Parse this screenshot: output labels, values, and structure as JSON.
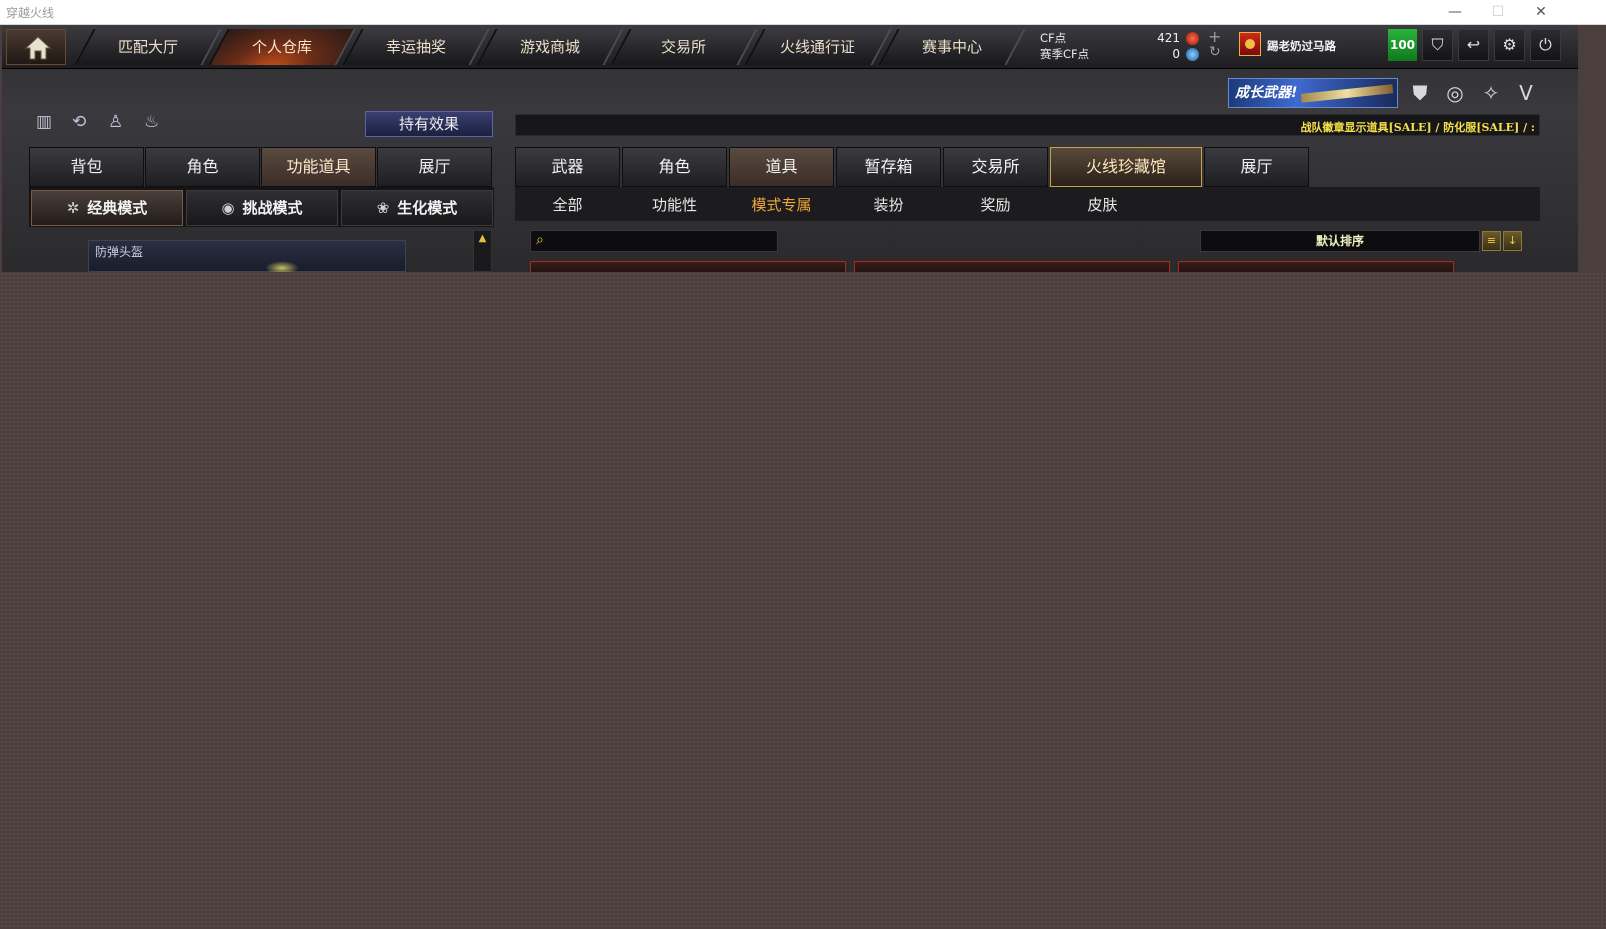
{
  "window": {
    "title": "穿越火线"
  },
  "nav": {
    "tabs": [
      {
        "label": "匹配大厅"
      },
      {
        "label": "个人仓库"
      },
      {
        "label": "幸运抽奖"
      },
      {
        "label": "游戏商城"
      },
      {
        "label": "交易所"
      },
      {
        "label": "火线通行证"
      },
      {
        "label": "赛事中心"
      }
    ],
    "active_tab": "个人仓库"
  },
  "currency": {
    "cf_label": "CF点",
    "season_cf_label": "赛季CF点",
    "cf_value": "421",
    "season_cf_value": "0"
  },
  "user": {
    "name": "踢老奶过马路",
    "level": "100"
  },
  "banner": {
    "text": "成长武器!"
  },
  "inventory": {
    "hold_effect_label": "持有效果",
    "tabs": [
      {
        "label": "背包"
      },
      {
        "label": "角色"
      },
      {
        "label": "功能道具"
      },
      {
        "label": "展厅"
      }
    ],
    "active_tab": "功能道具",
    "modes": [
      {
        "label": "经典模式"
      },
      {
        "label": "挑战模式"
      },
      {
        "label": "生化模式"
      }
    ],
    "active_mode": "经典模式",
    "item_label": "防弹头盔"
  },
  "store": {
    "ticker": "战队徽章显示道具[SALE] / 防化服[SALE] / :",
    "tabs": [
      {
        "label": "武器"
      },
      {
        "label": "角色"
      },
      {
        "label": "道具"
      },
      {
        "label": "暂存箱"
      },
      {
        "label": "交易所"
      },
      {
        "label": "火线珍藏馆"
      },
      {
        "label": "展厅"
      }
    ],
    "active_tab": "道具",
    "subtabs": [
      {
        "label": "全部"
      },
      {
        "label": "功能性"
      },
      {
        "label": "模式专属"
      },
      {
        "label": "装扮"
      },
      {
        "label": "奖励"
      },
      {
        "label": "皮肤"
      }
    ],
    "active_subtab": "模式专属",
    "search_placeholder": "",
    "sort_label": "默认排序"
  },
  "colors": {
    "accent_orange": "#f0a838",
    "ticker_yellow": "#f4e04a",
    "level_green": "#1e9a2e",
    "background": "#4b3f3c"
  }
}
